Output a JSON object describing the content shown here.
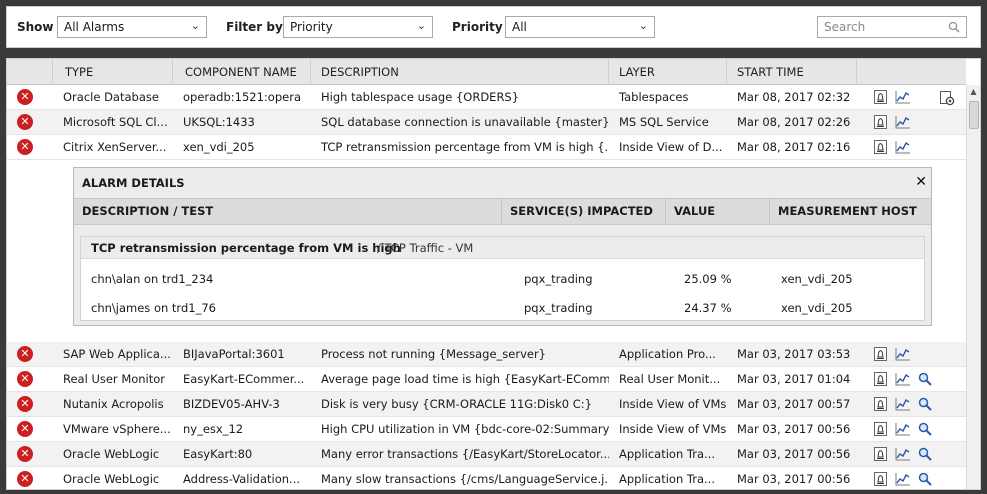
{
  "filters": {
    "show_label": "Show",
    "show_value": "All Alarms",
    "filterby_label": "Filter by",
    "filterby_value": "Priority",
    "priority_label": "Priority",
    "priority_value": "All",
    "search_placeholder": "Search"
  },
  "table": {
    "columns": [
      "TYPE",
      "COMPONENT NAME",
      "DESCRIPTION",
      "LAYER",
      "START TIME"
    ],
    "rows": [
      {
        "type": "Oracle Database",
        "component": "operadb:1521:opera",
        "description": "High tablespace usage {ORDERS}",
        "layer": "Tablespaces",
        "start": "Mar 08, 2017 02:32"
      },
      {
        "type": "Microsoft SQL Cl...",
        "component": "UKSQL:1433",
        "description": "SQL database connection is unavailable {master}",
        "layer": "MS SQL Service",
        "start": "Mar 08, 2017 02:26"
      },
      {
        "type": "Citrix XenServer...",
        "component": "xen_vdi_205",
        "description": "TCP retransmission percentage from VM is high {...",
        "layer": "Inside View of D...",
        "start": "Mar 08, 2017 02:16"
      },
      {
        "type": "SAP Web Applica...",
        "component": "BIJavaPortal:3601",
        "description": "Process not running {Message_server}",
        "layer": "Application Pro...",
        "start": "Mar 03, 2017 03:53"
      },
      {
        "type": "Real User Monitor",
        "component": "EasyKart-ECommer...",
        "description": "Average page load time is high {EasyKart-EComm...",
        "layer": "Real User Monit...",
        "start": "Mar 03, 2017 01:04"
      },
      {
        "type": "Nutanix Acropolis",
        "component": "BIZDEV05-AHV-3",
        "description": "Disk is very busy {CRM-ORACLE 11G:Disk0 C:}",
        "layer": "Inside View of VMs",
        "start": "Mar 03, 2017 00:57"
      },
      {
        "type": "VMware vSphere...",
        "component": "ny_esx_12",
        "description": "High CPU utilization in VM {bdc-core-02:Summary}",
        "layer": "Inside View of VMs",
        "start": "Mar 03, 2017 00:56"
      },
      {
        "type": "Oracle WebLogic",
        "component": "EasyKart:80",
        "description": "Many error transactions {/EasyKart/StoreLocator....",
        "layer": "Application Tra...",
        "start": "Mar 03, 2017 00:56"
      },
      {
        "type": "Oracle WebLogic",
        "component": "Address-Validation...",
        "description": "Many slow transactions {/cms/LanguageService.j...",
        "layer": "Application Tra...",
        "start": "Mar 03, 2017 00:56"
      }
    ]
  },
  "details": {
    "title": "ALARM DETAILS",
    "columns": [
      "DESCRIPTION / TEST",
      "SERVICE(S) IMPACTED",
      "VALUE",
      "MEASUREMENT HOST"
    ],
    "group_title": "TCP retransmission percentage from VM is high",
    "group_test": "/ TCP Traffic - VM",
    "rows": [
      {
        "desc": "chn\\alan on trd1_234",
        "service": "pqx_trading",
        "value": "25.09 %",
        "host": "xen_vdi_205"
      },
      {
        "desc": "chn\\james on trd1_76",
        "service": "pqx_trading",
        "value": "24.37 %",
        "host": "xen_vdi_205"
      }
    ]
  },
  "colors": {
    "critical": "#cc1f1f",
    "header_bg": "#e6e6e6",
    "frame": "#3a3a3a"
  }
}
